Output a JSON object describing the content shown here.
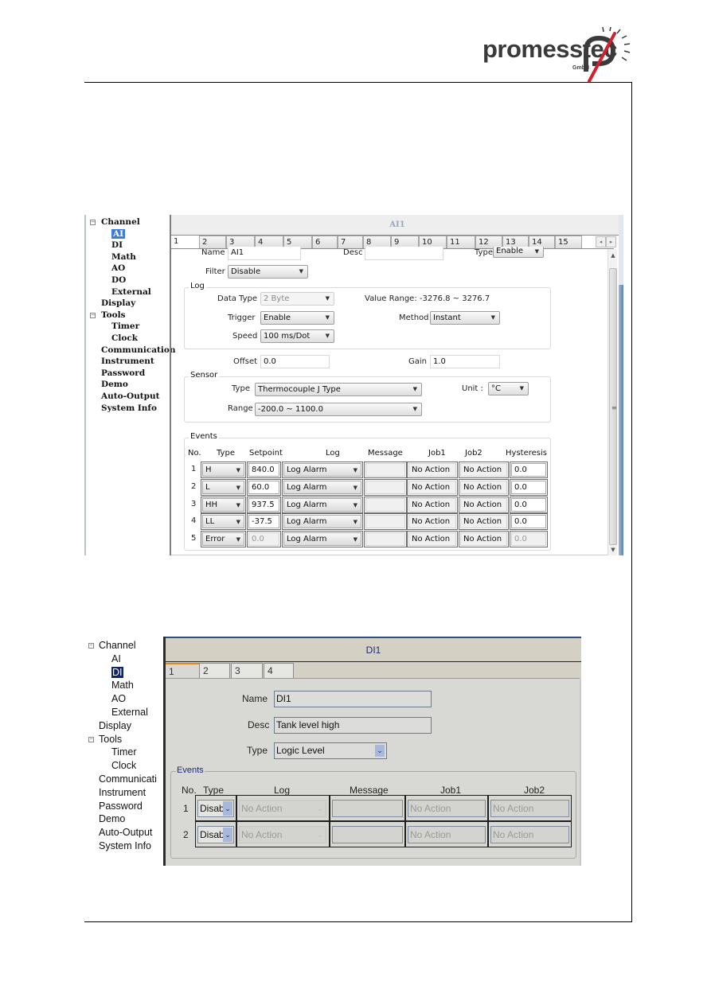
{
  "logo": {
    "brand": "promesstec",
    "sub": "GmbH",
    "accent": "#d3202e"
  },
  "screen_ai": {
    "tree": [
      {
        "label": "Channel",
        "level": 0,
        "expander": "−"
      },
      {
        "label": "AI",
        "level": 1,
        "selected": true
      },
      {
        "label": "DI",
        "level": 1
      },
      {
        "label": "Math",
        "level": 1
      },
      {
        "label": "AO",
        "level": 1
      },
      {
        "label": "DO",
        "level": 1
      },
      {
        "label": "External",
        "level": 1
      },
      {
        "label": "Display",
        "level": 0
      },
      {
        "label": "Tools",
        "level": 0,
        "expander": "−"
      },
      {
        "label": "Timer",
        "level": 1
      },
      {
        "label": "Clock",
        "level": 1
      },
      {
        "label": "Communication",
        "level": 0
      },
      {
        "label": "Instrument",
        "level": 0
      },
      {
        "label": "Password",
        "level": 0
      },
      {
        "label": "Demo",
        "level": 0
      },
      {
        "label": "Auto-Output",
        "level": 0
      },
      {
        "label": "System Info",
        "level": 0
      }
    ],
    "title": "AI1",
    "tabs": [
      "1",
      "2",
      "3",
      "4",
      "5",
      "6",
      "7",
      "8",
      "9",
      "10",
      "11",
      "12",
      "13",
      "14",
      "15"
    ],
    "active_tab": "1",
    "tab_scroll": {
      "left": "◂",
      "right": "▸"
    },
    "fields": {
      "name_label": "Name",
      "name_value": "AI1",
      "desc_label": "Desc",
      "desc_value": "",
      "type_label": "Type",
      "type_value": "Enable",
      "filter_label": "Filter",
      "filter_value": "Disable"
    },
    "log": {
      "legend": "Log",
      "data_type_label": "Data Type",
      "data_type_value": "2 Byte",
      "value_range": "Value Range: -3276.8 ~ 3276.7",
      "trigger_label": "Trigger",
      "trigger_value": "Enable",
      "method_label": "Method",
      "method_value": "Instant",
      "speed_label": "Speed",
      "speed_value": "100 ms/Dot"
    },
    "offset_label": "Offset",
    "offset_value": "0.0",
    "gain_label": "Gain",
    "gain_value": "1.0",
    "sensor": {
      "legend": "Sensor",
      "type_label": "Type",
      "type_value": "Thermocouple J Type",
      "unit_label": "Unit :",
      "unit_value": "°C",
      "range_label": "Range",
      "range_value": "-200.0 ~ 1100.0"
    },
    "events": {
      "legend": "Events",
      "headers": [
        "No.",
        "Type",
        "Setpoint",
        "Log",
        "Message",
        "Job1",
        "Job2",
        "Hysteresis"
      ],
      "rows": [
        {
          "no": "1",
          "type": "H",
          "setpoint": "840.0",
          "log": "Log Alarm",
          "message": "",
          "job1": "No Action",
          "job2": "No Action",
          "hysteresis": "0.0"
        },
        {
          "no": "2",
          "type": "L",
          "setpoint": "60.0",
          "log": "Log Alarm",
          "message": "",
          "job1": "No Action",
          "job2": "No Action",
          "hysteresis": "0.0"
        },
        {
          "no": "3",
          "type": "HH",
          "setpoint": "937.5",
          "log": "Log Alarm",
          "message": "",
          "job1": "No Action",
          "job2": "No Action",
          "hysteresis": "0.0"
        },
        {
          "no": "4",
          "type": "LL",
          "setpoint": "-37.5",
          "log": "Log Alarm",
          "message": "",
          "job1": "No Action",
          "job2": "No Action",
          "hysteresis": "0.0"
        },
        {
          "no": "5",
          "type": "Error",
          "setpoint": "0.0",
          "log": "Log Alarm",
          "message": "",
          "job1": "No Action",
          "job2": "No Action",
          "hysteresis": "0.0",
          "disabled": true
        }
      ]
    },
    "scroll_glyphs": {
      "up": "▲",
      "down": "▼",
      "grip": "≡"
    }
  },
  "screen_di": {
    "tree": [
      {
        "label": "Channel",
        "level": 0,
        "expander": "−"
      },
      {
        "label": "AI",
        "level": 1
      },
      {
        "label": "DI",
        "level": 1,
        "selected": true
      },
      {
        "label": "Math",
        "level": 1
      },
      {
        "label": "AO",
        "level": 1
      },
      {
        "label": "External",
        "level": 1
      },
      {
        "label": "Display",
        "level": 0
      },
      {
        "label": "Tools",
        "level": 0,
        "expander": "−"
      },
      {
        "label": "Timer",
        "level": 1
      },
      {
        "label": "Clock",
        "level": 1
      },
      {
        "label": "Communicati",
        "level": 0
      },
      {
        "label": "Instrument",
        "level": 0
      },
      {
        "label": "Password",
        "level": 0
      },
      {
        "label": "Demo",
        "level": 0
      },
      {
        "label": "Auto-Output",
        "level": 0
      },
      {
        "label": "System Info",
        "level": 0
      }
    ],
    "title": "DI1",
    "tabs": [
      "1",
      "2",
      "3",
      "4"
    ],
    "active_tab": "1",
    "fields": {
      "name_label": "Name",
      "name_value": "DI1",
      "desc_label": "Desc",
      "desc_value": "Tank level high",
      "type_label": "Type",
      "type_value": "Logic Level"
    },
    "events": {
      "legend": "Events",
      "headers": [
        "No.",
        "Type",
        "Log",
        "Message",
        "Job1",
        "Job2"
      ],
      "rows": [
        {
          "no": "1",
          "type": "Disab",
          "log": "No Action",
          "message": "",
          "job1": "No Action",
          "job2": "No Action"
        },
        {
          "no": "2",
          "type": "Disab",
          "log": "No Action",
          "message": "",
          "job1": "No Action",
          "job2": "No Action"
        }
      ]
    },
    "dropdown_glyph": "⌄"
  }
}
